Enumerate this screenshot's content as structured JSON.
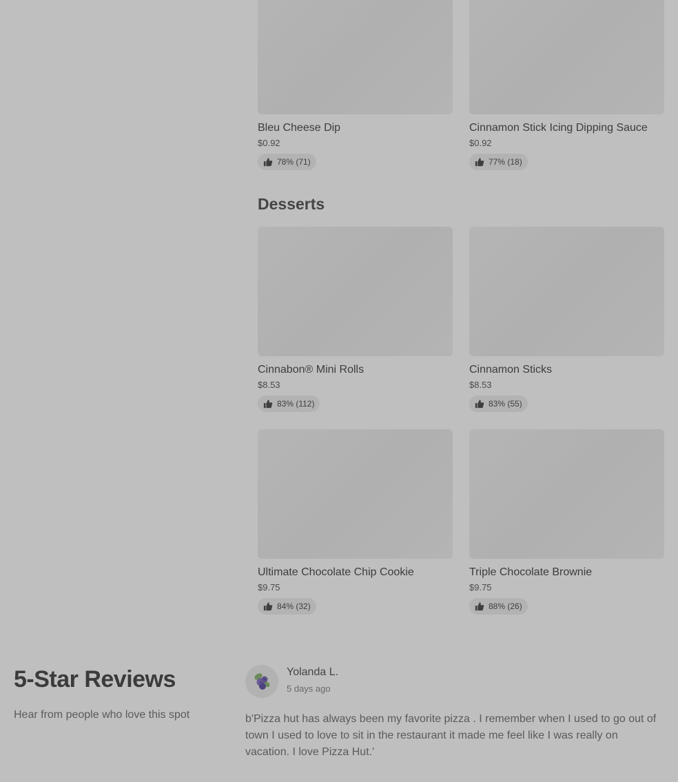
{
  "sides": {
    "items": [
      {
        "name": "Bleu Cheese Dip",
        "price": "$0.92",
        "rating": "78% (71)"
      },
      {
        "name": "Cinnamon Stick Icing Dipping Sauce",
        "price": "$0.92",
        "rating": "77% (18)"
      }
    ]
  },
  "desserts": {
    "title": "Desserts",
    "items": [
      {
        "name": "Cinnabon® Mini Rolls",
        "price": "$8.53",
        "rating": "83% (112)"
      },
      {
        "name": "Cinnamon Sticks",
        "price": "$8.53",
        "rating": "83% (55)"
      },
      {
        "name": "Ultimate Chocolate Chip Cookie",
        "price": "$9.75",
        "rating": "84% (32)"
      },
      {
        "name": "Triple Chocolate Brownie",
        "price": "$9.75",
        "rating": "88% (26)"
      }
    ]
  },
  "reviews": {
    "title": "5-Star Reviews",
    "subtitle": "Hear from people who love this spot",
    "items": [
      {
        "reviewer": "Yolanda L.",
        "date": "5 days ago",
        "avatar_icon": "blueberry-avatar-icon",
        "text": "b'Pizza hut has always been my favorite pizza . I remember when I used to go out of town I used to love to sit in the restaurant it made me feel like I was really on vacation. I love Pizza Hut.'"
      }
    ]
  },
  "icons": {
    "rating": "thumbs-up-icon"
  }
}
